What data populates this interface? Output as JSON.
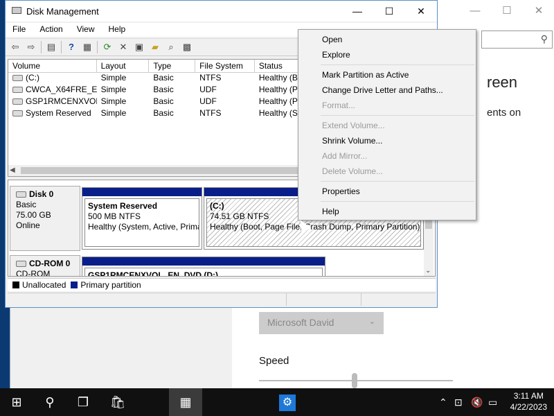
{
  "settings": {
    "heading": "reen",
    "subtext": "ents on",
    "voice_value": "Microsoft David",
    "speed_label": "Speed",
    "speed_level": 0.5,
    "title_controls": [
      "—",
      "☐",
      "✕"
    ]
  },
  "disk_management": {
    "title": "Disk Management",
    "window_controls": [
      "—",
      "☐",
      "✕"
    ],
    "menu": [
      "File",
      "Action",
      "View",
      "Help"
    ],
    "toolbar_icons": [
      "back-icon",
      "forward-icon",
      "console-tree-icon",
      "help-icon",
      "properties-pane-icon",
      "refresh-icon",
      "delete-icon",
      "properties-icon",
      "open-icon",
      "explore-icon",
      "settings-icon"
    ],
    "columns": [
      "Volume",
      "Layout",
      "Type",
      "File System",
      "Status"
    ],
    "volumes": [
      {
        "volume": "(C:)",
        "layout": "Simple",
        "type": "Basic",
        "fs": "NTFS",
        "status": "Healthy (B"
      },
      {
        "volume": "CWCA_X64FRE_EN...",
        "layout": "Simple",
        "type": "Basic",
        "fs": "UDF",
        "status": "Healthy (P"
      },
      {
        "volume": "GSP1RMCENXVOL...",
        "layout": "Simple",
        "type": "Basic",
        "fs": "UDF",
        "status": "Healthy (P"
      },
      {
        "volume": "System Reserved",
        "layout": "Simple",
        "type": "Basic",
        "fs": "NTFS",
        "status": "Healthy (S"
      }
    ],
    "disk0": {
      "name": "Disk 0",
      "type": "Basic",
      "size": "75.00 GB",
      "state": "Online",
      "partitions": [
        {
          "name": "System Reserved",
          "size": "500 MB NTFS",
          "status": "Healthy (System, Active, Prima"
        },
        {
          "name": "(C:)",
          "size": "74.51 GB NTFS",
          "status": "Healthy (Boot, Page File, Crash Dump, Primary Partition)"
        }
      ]
    },
    "cdrom0": {
      "name": "CD-ROM 0",
      "type": "CD-ROM",
      "partition": "GSP1RMCENXVOL_EN_DVD (D:)"
    },
    "legend": {
      "unallocated": "Unallocated",
      "primary": "Primary partition",
      "unallocated_color": "#000000",
      "primary_color": "#0a1e8a"
    }
  },
  "context_menu": {
    "groups": [
      [
        {
          "label": "Open",
          "enabled": true
        },
        {
          "label": "Explore",
          "enabled": true
        }
      ],
      [
        {
          "label": "Mark Partition as Active",
          "enabled": true
        },
        {
          "label": "Change Drive Letter and Paths...",
          "enabled": true
        },
        {
          "label": "Format...",
          "enabled": false
        }
      ],
      [
        {
          "label": "Extend Volume...",
          "enabled": false
        },
        {
          "label": "Shrink Volume...",
          "enabled": true
        },
        {
          "label": "Add Mirror...",
          "enabled": false
        },
        {
          "label": "Delete Volume...",
          "enabled": false
        }
      ],
      [
        {
          "label": "Properties",
          "enabled": true
        }
      ],
      [
        {
          "label": "Help",
          "enabled": true
        }
      ]
    ]
  },
  "taskbar": {
    "time": "3:11 AM",
    "date": "4/22/2023",
    "accent": "#1e78d7"
  }
}
